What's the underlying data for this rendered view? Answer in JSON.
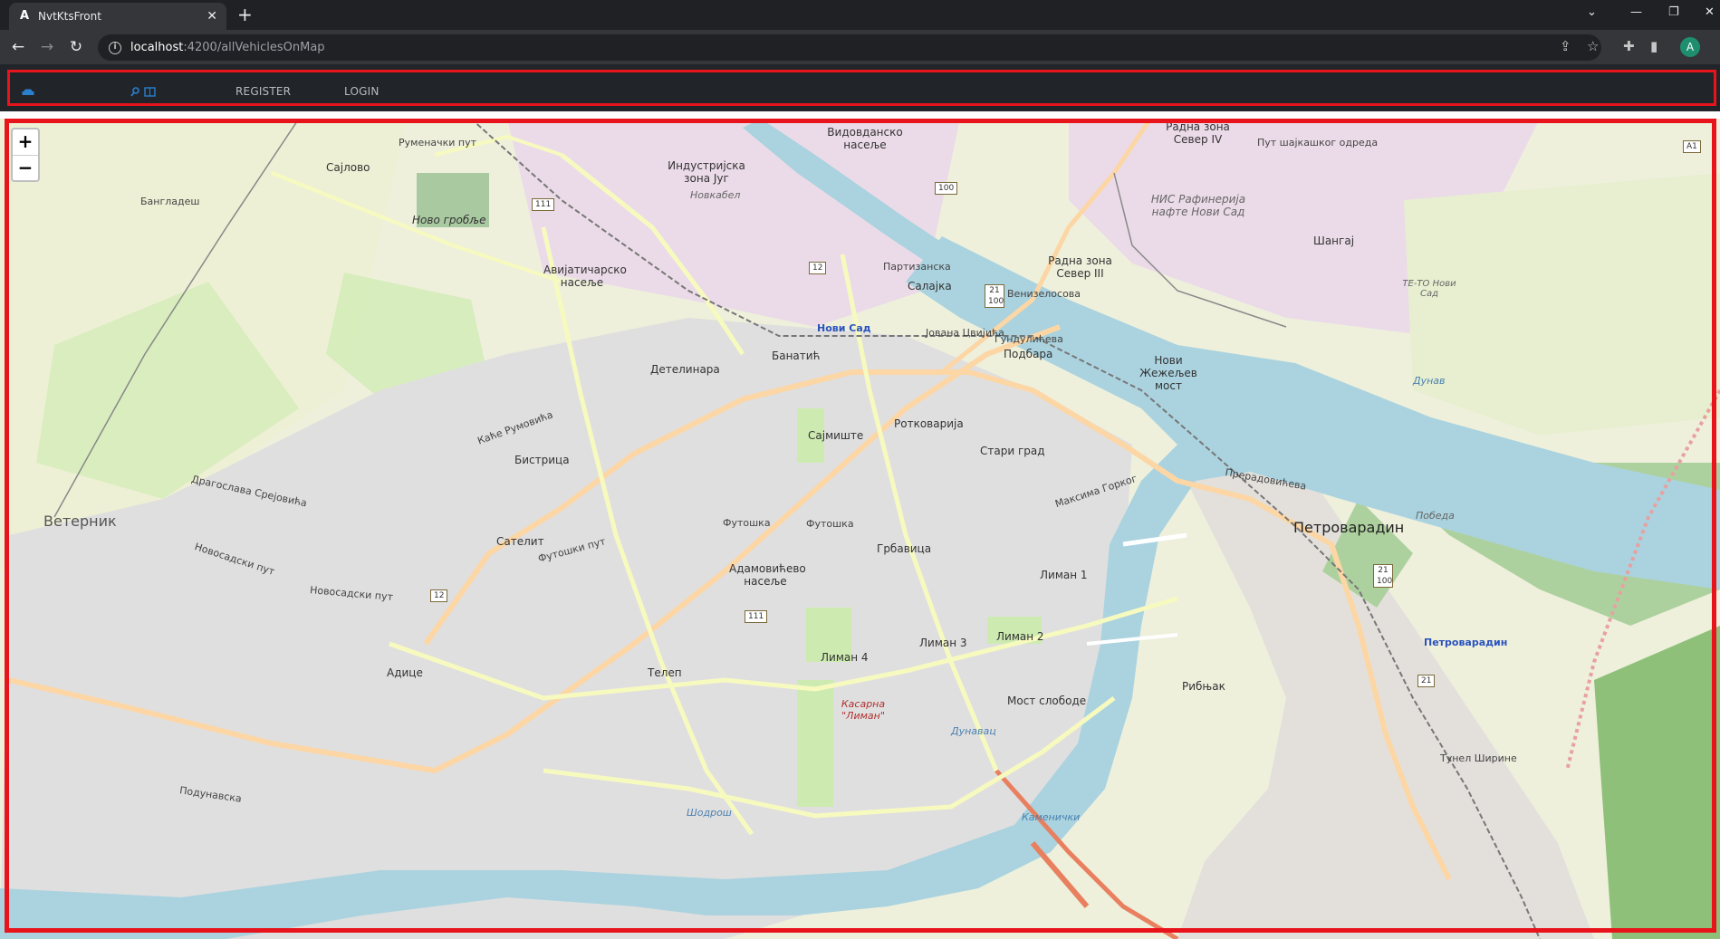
{
  "browser": {
    "tab_title": "NvtKtsFront",
    "tab_favicon": "A",
    "url_host": "localhost",
    "url_path": ":4200/allVehiclesOnMap",
    "avatar_letter": "A"
  },
  "navbar": {
    "items": [
      {
        "label": "REGISTER"
      },
      {
        "label": "LOGIN"
      }
    ],
    "car_icon": "car-icon",
    "search_icon": "search-icon",
    "book_icon": "book-icon"
  },
  "map": {
    "zoom_in": "+",
    "zoom_out": "−",
    "labels": {
      "sajlovo": "Сајлово",
      "bangladesh": "Бангладеш",
      "rumenacki_put": "Руменачки пут",
      "novo_groblje": "Ново гробље",
      "vidovdansko": "Видовданско насеље",
      "industrijska": "Индустријска зона Југ",
      "novkabel": "Новкабел",
      "radna_zona_4": "Радна зона Север IV",
      "put_sajkaskog": "Пут шајкашког одреда",
      "nis": "НИС Рафинерија нафте Нови Сад",
      "sangaj": "Шангај",
      "te_to": "ТЕ-ТО Нови Сад",
      "radna_zona_3": "Радна зона Север III",
      "avijaticarsko": "Авијатичарско насеље",
      "partizanska": "Партизанска",
      "salajka": "Салајка",
      "venizelosova": "Венизелосова",
      "novi_sad": "Нови Сад",
      "jovana_cvijica": "Јована Цвијића",
      "gundulićeva": "Гундулићева",
      "podbara": "Подбара",
      "novi_zezeljev": "Нови Жежељев мост",
      "dunav1": "Дунав",
      "banatic": "Банатић",
      "detelinara": "Детелинара",
      "rotkvarija": "Ротковарија",
      "sajmiste": "Сајмиште",
      "stari_grad": "Стари град",
      "bistrica": "Бистрица",
      "kaca_rumovica": "Каће Румовића",
      "dragoslava": "Драгослава Срејовића",
      "veternik": "Ветерник",
      "satelit": "Сателит",
      "futoska": "Футошка",
      "futoski_put": "Футошки пут",
      "novosadski_put": "Новосадски пут",
      "grbavica": "Грбавица",
      "adamovicevo": "Адамовићево насеље",
      "maksima_gorkog": "Максима Горког",
      "liman1": "Лиман 1",
      "liman2": "Лиман 2",
      "liman3": "Лиман 3",
      "liman4": "Лиман 4",
      "petrovaradin": "Петроварадин",
      "petrovaradin_st": "Петроварадин",
      "pobeda": "Победа",
      "preradoviceva": "Прерадовићева",
      "adice": "Адице",
      "telep": "Телеп",
      "most_slobode": "Мост слободе",
      "ribnjak": "Рибњак",
      "kasarna": "Касарна \"Лиман\"",
      "dunavac": "Дунавац",
      "sodros": "Шодрош",
      "podunavska": "Подунавска",
      "tunel": "Тунел Ширине",
      "kamenicki": "Каменички"
    },
    "shields": [
      "111",
      "12",
      "100",
      "21 100",
      "12",
      "111",
      "21 100",
      "21",
      "A1"
    ],
    "colors": {
      "land": "#f2efe9",
      "water": "#aad3df",
      "urban": "#e0dfdf",
      "forest": "#add19e",
      "grass": "#cdebb0",
      "industrial": "#ebdbe8",
      "primary_road": "#fcd6a4",
      "secondary_road": "#f7fabf",
      "highlight": "#e8141c"
    }
  }
}
